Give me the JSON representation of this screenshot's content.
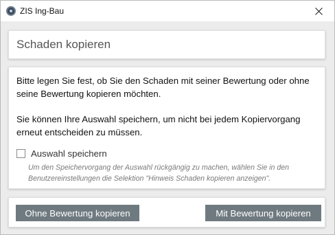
{
  "window": {
    "title": "ZIS Ing-Bau",
    "app_icon": "zis-logo-icon",
    "close_icon": "close-icon"
  },
  "header": {
    "title": "Schaden kopieren"
  },
  "body": {
    "paragraph1": "Bitte legen Sie fest, ob Sie den Schaden mit seiner Bewertung oder ohne seine Bewertung kopieren möchten.",
    "paragraph2": "Sie können Ihre Auswahl speichern, um nicht bei jedem Kopiervorgang erneut entscheiden zu müssen.",
    "checkbox_label": "Auswahl speichern",
    "checkbox_checked": false,
    "hint": "Um den Speichervorgang der Auswahl rückgängig zu machen, wählen Sie in den Benutzereinstellungen die Selektion \"Hinweis Schaden kopieren anzeigen\"."
  },
  "footer": {
    "without_label": "Ohne Bewertung kopieren",
    "with_label": "Mit Bewertung kopieren"
  },
  "colors": {
    "button_bg": "#6f7a80",
    "window_bg": "#ececec",
    "hint_text": "#7a7a7a"
  }
}
